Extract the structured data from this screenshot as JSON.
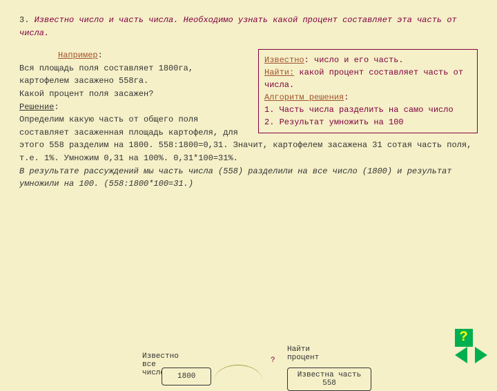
{
  "title": {
    "num": "3.",
    "lead": "Известно число и часть числа.",
    "tail": " Необходимо узнать какой процент составляет эта часть от числа."
  },
  "box": {
    "kLabel": "Известно",
    "kText": ": число и его часть.",
    "fLabel": "Найти:",
    "fText": " какой процент составляет часть от числа.",
    "aLabel": "Алгоритм решения",
    "aColon": ":",
    "s1": "1. Часть числа разделить на само число",
    "s2": "2. Результат умножить на 100"
  },
  "ex": {
    "label": "Например",
    "colon": ":",
    "p1": "Вся площадь поля составляет 1800га, картофелем засажено 558га.",
    "p2": "Какой процент поля засажен?",
    "solLabel": "Решение",
    "sol": "Определим какую часть от общего поля составляет засаженная площадь картофеля, для этого 558 разделим на 1800. 558:1800=0,31. Значит, картофелем засажена 31 сотая часть поля, т.е. 1%. Умножим 0,31 на 100%. 0,31*100=31%.",
    "concl": "В результате рассуждений мы часть числа (558) разделили на все число (1800) и результат умножили на 100. (558:1800*100=31.)"
  },
  "diag": {
    "whole": "Известно все число",
    "wVal": "1800",
    "find": "Найти процент",
    "q": "?",
    "part": "Известна часть 558"
  },
  "icons": {
    "help": "?",
    "prev": "prev",
    "next": "next"
  }
}
